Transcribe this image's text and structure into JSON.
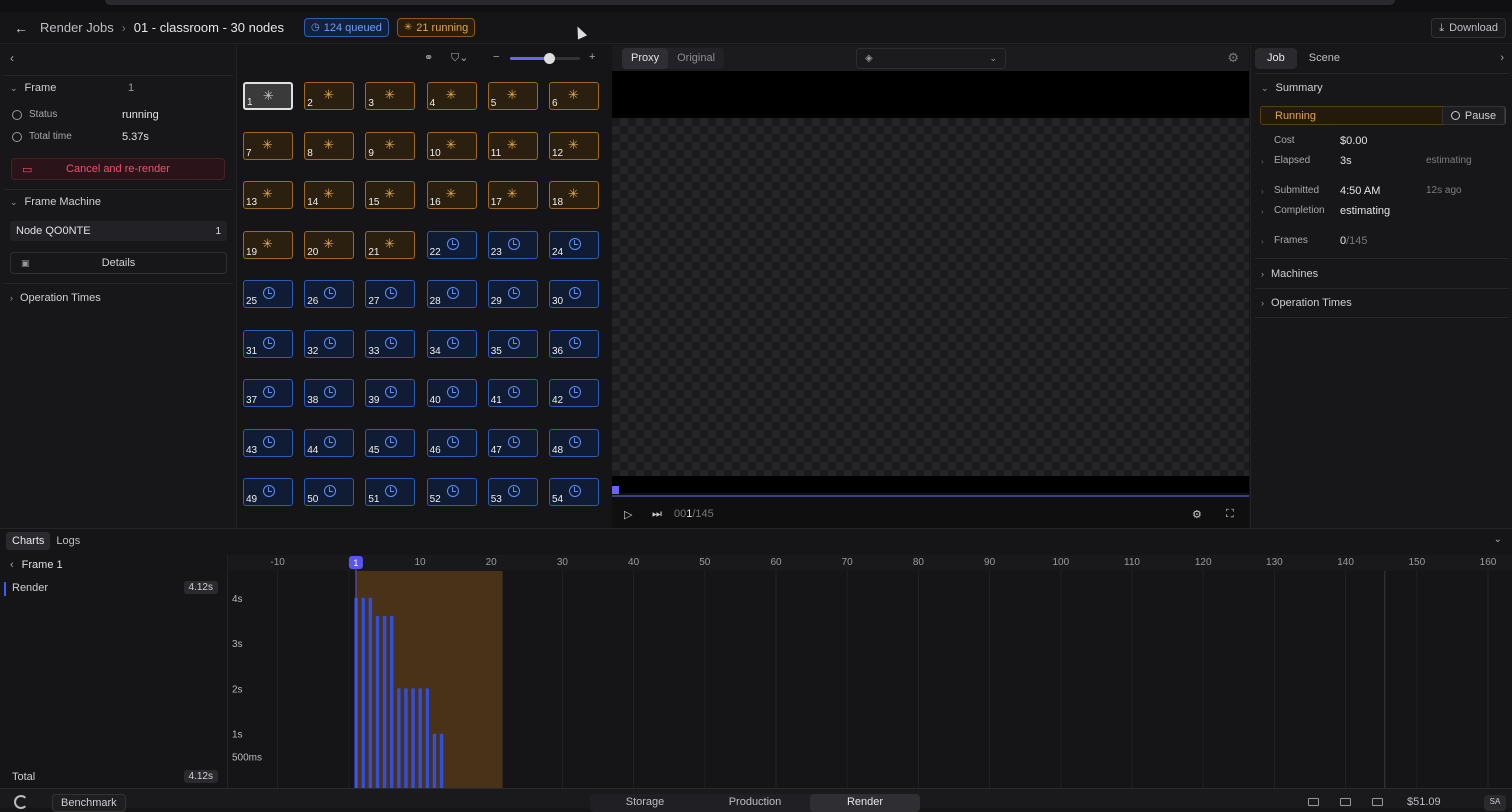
{
  "header": {
    "breadcrumb_root": "Render Jobs",
    "breadcrumb_sep": "›",
    "job_name": "01 - classroom - 30 nodes",
    "queued_badge": "124 queued",
    "running_badge": "21 running",
    "download_label": "Download"
  },
  "left_panel": {
    "frame_label": "Frame",
    "frame_number": "1",
    "status_label": "Status",
    "status_value": "running",
    "total_time_label": "Total time",
    "total_time_value": "5.37s",
    "cancel_button": "Cancel and re-render",
    "frame_machine_label": "Frame Machine",
    "node_name": "Node QO0NTE",
    "node_count": "1",
    "details_button": "Details",
    "operation_times_label": "Operation Times"
  },
  "frames": {
    "selected": 1,
    "running": [
      1,
      2,
      3,
      4,
      5,
      6,
      7,
      8,
      9,
      10,
      11,
      12,
      13,
      14,
      15,
      16,
      17,
      18,
      19,
      20,
      21
    ],
    "queued": [
      22,
      23,
      24,
      25,
      26,
      27,
      28,
      29,
      30,
      31,
      32,
      33,
      34,
      35,
      36,
      37,
      38,
      39,
      40,
      41,
      42,
      43,
      44,
      45,
      46,
      47,
      48,
      49,
      50,
      51,
      52,
      53,
      54
    ],
    "zoom_fraction": 0.55
  },
  "preview": {
    "tab_proxy": "Proxy",
    "tab_original": "Original",
    "frame_counter_prefix": "00",
    "frame_counter_current": "1",
    "frame_counter_total": "/145"
  },
  "right_panel": {
    "tab_job": "Job",
    "tab_scene": "Scene",
    "summary_label": "Summary",
    "status": "Running",
    "pause_button": "Pause",
    "cost_label": "Cost",
    "cost_value": "$0.00",
    "elapsed_label": "Elapsed",
    "elapsed_value": "3s",
    "elapsed_note": "estimating",
    "submitted_label": "Submitted",
    "submitted_value": "4:50 AM",
    "submitted_note": "12s ago",
    "completion_label": "Completion",
    "completion_value": "estimating",
    "frames_label": "Frames",
    "frames_done": "0",
    "frames_total": "/145",
    "machines_label": "Machines",
    "operation_times_label": "Operation Times"
  },
  "bottom": {
    "tab_charts": "Charts",
    "tab_logs": "Logs",
    "frame_title": "Frame 1",
    "render_label": "Render",
    "render_value": "4.12s",
    "total_label": "Total",
    "total_value": "4.12s"
  },
  "chart_data": {
    "type": "bar",
    "x_ticks": [
      "-10",
      "10",
      "20",
      "30",
      "40",
      "50",
      "60",
      "70",
      "80",
      "90",
      "100",
      "110",
      "120",
      "130",
      "140",
      "150",
      "160"
    ],
    "y_ticks": [
      "4s",
      "3s",
      "2s",
      "1s",
      "500ms"
    ],
    "marker_label": "1",
    "colors": {
      "bar": "#2f4fe0",
      "range": "#4a3218"
    },
    "bars": [
      {
        "frame": 1,
        "value": 4.0
      },
      {
        "frame": 2,
        "value": 4.0
      },
      {
        "frame": 3,
        "value": 4.0
      },
      {
        "frame": 4,
        "value": 3.6
      },
      {
        "frame": 5,
        "value": 3.6
      },
      {
        "frame": 6,
        "value": 3.6
      },
      {
        "frame": 7,
        "value": 2.0
      },
      {
        "frame": 8,
        "value": 2.0
      },
      {
        "frame": 9,
        "value": 2.0
      },
      {
        "frame": 10,
        "value": 2.0
      },
      {
        "frame": 11,
        "value": 2.0
      },
      {
        "frame": 12,
        "value": 1.0
      },
      {
        "frame": 13,
        "value": 1.0
      }
    ],
    "running_range": [
      1,
      21
    ]
  },
  "footer": {
    "project": "Benchmark",
    "nav_storage": "Storage",
    "nav_production": "Production",
    "nav_render": "Render",
    "credit": "$51.09",
    "avatar": "SA"
  }
}
